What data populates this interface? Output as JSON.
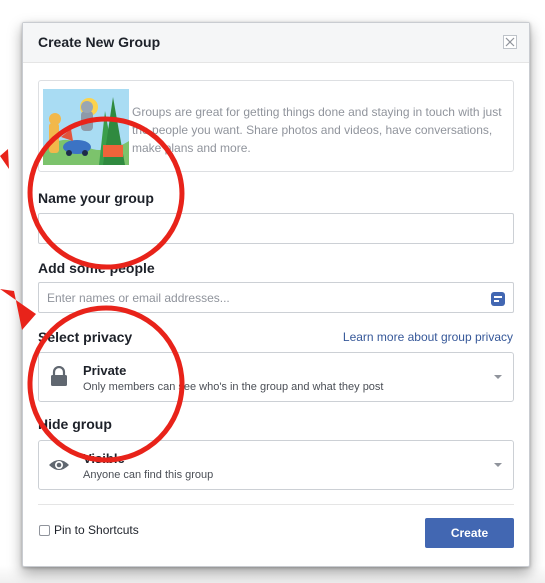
{
  "dialog": {
    "title": "Create New Group"
  },
  "intro": {
    "text": "Groups are great for getting things done and staying in touch with just the people you want. Share photos and videos, have conversations, make plans and more."
  },
  "name_section": {
    "label": "Name your group",
    "value": ""
  },
  "people_section": {
    "label": "Add some people",
    "placeholder": "Enter names or email addresses..."
  },
  "privacy_section": {
    "label": "Select privacy",
    "link": "Learn more about group privacy",
    "selected_title": "Private",
    "selected_desc": "Only members can see who's in the group and what they post"
  },
  "hide_section": {
    "label": "Hide group",
    "selected_title": "Visible",
    "selected_desc": "Anyone can find this group"
  },
  "footer": {
    "pin_label": "Pin to Shortcuts",
    "create_label": "Create"
  },
  "colors": {
    "brand": "#4267b2",
    "link": "#365899",
    "annotation": "#e8231a"
  }
}
